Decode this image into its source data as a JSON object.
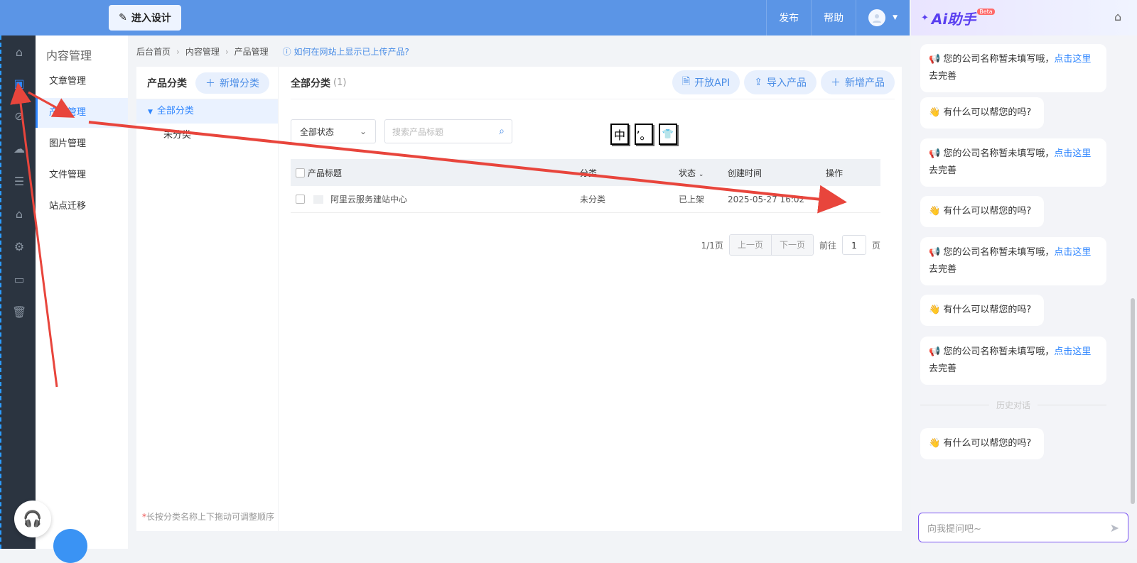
{
  "topbar": {
    "design_button": "进入设计",
    "publish": "发布",
    "help": "帮助"
  },
  "sidebar": {
    "title": "内容管理",
    "items": [
      "文章管理",
      "产品管理",
      "图片管理",
      "文件管理",
      "站点迁移"
    ]
  },
  "breadcrumb": {
    "items": [
      "后台首页",
      "内容管理",
      "产品管理"
    ],
    "tip": "如何在网站上显示已上传产品?"
  },
  "category": {
    "title": "产品分类",
    "add_button": "新增分类",
    "tree": [
      "全部分类",
      "未分类"
    ],
    "footer": "长按分类名称上下拖动可调整顺序"
  },
  "main": {
    "title": "全部分类",
    "count": "(1)",
    "buttons": [
      "开放API",
      "导入产品",
      "新增产品"
    ],
    "status_select": "全部状态",
    "search_placeholder": "搜索产品标题",
    "glyphs": [
      "中",
      "’。",
      "👕"
    ],
    "columns": [
      "产品标题",
      "分类",
      "状态",
      "创建时间",
      "操作"
    ],
    "rows": [
      {
        "title": "阿里云服务建站中心",
        "category": "未分类",
        "status": "已上架",
        "created": "2025-05-27 16:02"
      }
    ],
    "pager": {
      "info": "1/1页",
      "prev": "上一页",
      "next": "下一页",
      "goto": "前往",
      "page": "1",
      "unit": "页"
    }
  },
  "ai": {
    "logo": "Ai助手",
    "beta": "Beta",
    "msg_company_a": "您的公司名称暂未填写哦，",
    "msg_company_link": "点击这里",
    "msg_company_b": "去完善",
    "msg_help": "有什么可以帮您的吗?",
    "history": "历史对话",
    "input_placeholder": "向我提问吧~"
  },
  "colors": {
    "accent": "#2f86ff",
    "topbar": "#5b95e6",
    "annotation": "#e8453c"
  }
}
